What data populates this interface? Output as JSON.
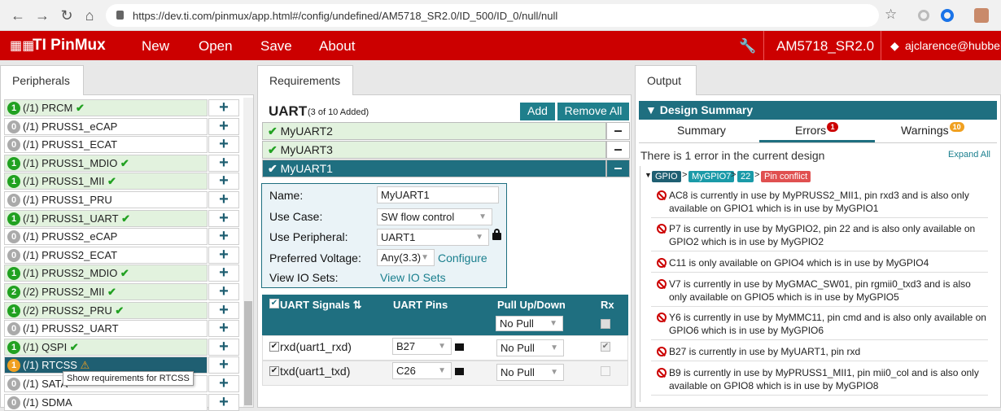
{
  "browser": {
    "url": "https://dev.ti.com/pinmux/app.html#/config/undefined/AM5718_SR2.0/ID_500/ID_0/null/null"
  },
  "header": {
    "app_name": "TI PinMux",
    "menu": [
      "New",
      "Open",
      "Save",
      "About"
    ],
    "device": "AM5718_SR2.0",
    "user": "ajclarence@hubbel"
  },
  "colors": {
    "header_red": "#cc0000",
    "teal": "#1f6f80",
    "ok_green": "#21a121"
  },
  "peripherals": {
    "tab": "Peripherals",
    "items": [
      {
        "badge": "1",
        "label": "(/1) PRCM",
        "state": "ok"
      },
      {
        "badge": "0",
        "label": "(/1) PRUSS1_eCAP",
        "state": "none"
      },
      {
        "badge": "0",
        "label": "(/1) PRUSS1_ECAT",
        "state": "none"
      },
      {
        "badge": "1",
        "label": "(/1) PRUSS1_MDIO",
        "state": "ok"
      },
      {
        "badge": "1",
        "label": "(/1) PRUSS1_MII",
        "state": "ok"
      },
      {
        "badge": "0",
        "label": "(/1) PRUSS1_PRU",
        "state": "none"
      },
      {
        "badge": "1",
        "label": "(/1) PRUSS1_UART",
        "state": "ok"
      },
      {
        "badge": "0",
        "label": "(/1) PRUSS2_eCAP",
        "state": "none"
      },
      {
        "badge": "0",
        "label": "(/1) PRUSS2_ECAT",
        "state": "none"
      },
      {
        "badge": "1",
        "label": "(/1) PRUSS2_MDIO",
        "state": "ok"
      },
      {
        "badge": "2",
        "label": "(/2) PRUSS2_MII",
        "state": "ok"
      },
      {
        "badge": "1",
        "label": "(/2) PRUSS2_PRU",
        "state": "ok"
      },
      {
        "badge": "0",
        "label": "(/1) PRUSS2_UART",
        "state": "none"
      },
      {
        "badge": "1",
        "label": "(/1) QSPI",
        "state": "ok"
      },
      {
        "badge": "1",
        "label": "(/1) RTCSS",
        "state": "warn"
      },
      {
        "badge": "0",
        "label": "(/1) SATA",
        "state": "none"
      },
      {
        "badge": "0",
        "label": "(/1) SDMA",
        "state": "none"
      }
    ],
    "tooltip": "Show requirements for RTCSS"
  },
  "requirements": {
    "tab": "Requirements",
    "title": "UART",
    "subtitle": "(3 of 10 Added)",
    "add_label": "Add",
    "remove_all_label": "Remove All",
    "instances": [
      "MyUART2",
      "MyUART3",
      "MyUART1"
    ],
    "form": {
      "name_label": "Name:",
      "name_value": "MyUART1",
      "usecase_label": "Use Case:",
      "usecase_value": "SW flow control",
      "periph_label": "Use Peripheral:",
      "periph_value": "UART1",
      "voltage_label": "Preferred Voltage:",
      "voltage_value": "Any(3.3)",
      "configure_label": "Configure",
      "iosets_label": "View IO Sets:",
      "iosets_link": "View IO Sets"
    },
    "signals": {
      "headers": [
        "UART Signals",
        "UART Pins",
        "Pull Up/Down",
        "Rx"
      ],
      "header_pull": "No Pull",
      "rows": [
        {
          "signal": "rxd(uart1_rxd)",
          "pin": "B27",
          "pull": "No Pull",
          "rx": true
        },
        {
          "signal": "txd(uart1_txd)",
          "pin": "C26",
          "pull": "No Pull",
          "rx": false
        }
      ]
    }
  },
  "output": {
    "tab": "Output",
    "section": "Design Summary",
    "tabs": [
      {
        "label": "Summary"
      },
      {
        "label": "Errors",
        "count": "1"
      },
      {
        "label": "Warnings",
        "count": "10"
      }
    ],
    "status": "There is 1 error in the current design",
    "expand_all": "Expand All",
    "crumbs": [
      "GPIO",
      "MyGPIO7",
      "22",
      "Pin conflict"
    ],
    "errors": [
      "AC8 is currently in use by MyPRUSS2_MII1, pin rxd3 and is also only available on GPIO1 which is in use by MyGPIO1",
      "P7 is currently in use by MyGPIO2, pin 22 and is also only available on GPIO2 which is in use by MyGPIO2",
      "C11 is only available on GPIO4 which is in use by MyGPIO4",
      "V7 is currently in use by MyGMAC_SW01, pin rgmii0_txd3 and is also only available on GPIO5 which is in use by MyGPIO5",
      "Y6 is currently in use by MyMMC11, pin cmd and is also only available on GPIO6 which is in use by MyGPIO6",
      "B27 is currently in use by MyUART1, pin rxd",
      "B9 is currently in use by MyPRUSS1_MII1, pin mii0_col and is also only available on GPIO8 which is in use by MyGPIO8"
    ]
  }
}
